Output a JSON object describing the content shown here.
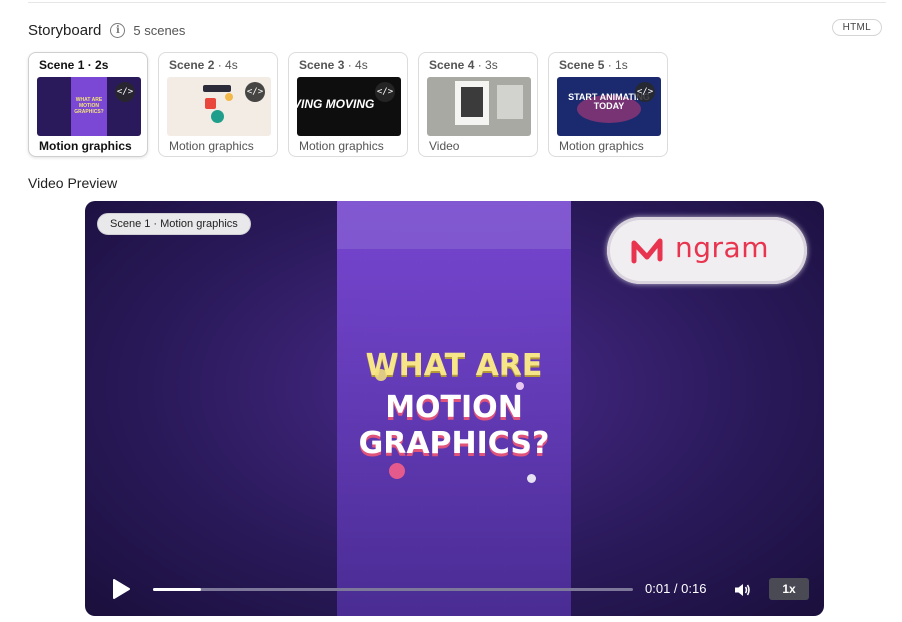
{
  "storyboard": {
    "title": "Storyboard",
    "scene_count": "5 scenes",
    "badge": "HTML"
  },
  "scenes": [
    {
      "label": "Scene 1",
      "duration": "· 2s",
      "type": "Motion graphics",
      "active": true,
      "thumb_text": "WHAT ARE MOTION GRAPHICS?"
    },
    {
      "label": "Scene 2",
      "duration": "· 4s",
      "type": "Motion graphics",
      "active": false
    },
    {
      "label": "Scene 3",
      "duration": "· 4s",
      "type": "Motion graphics",
      "active": false,
      "thumb_text": "VING MOVING"
    },
    {
      "label": "Scene 4",
      "duration": "· 3s",
      "type": "Video",
      "active": false
    },
    {
      "label": "Scene 5",
      "duration": "· 1s",
      "type": "Motion graphics",
      "active": false,
      "thumb_text": "START ANIMATING TODAY"
    }
  ],
  "preview": {
    "label": "Video Preview",
    "scene_tag": "Scene 1 · Motion graphics",
    "logo_text": "ngram",
    "title_line1": "WHAT ARE",
    "title_line2": "MOTION",
    "title_line3": "GRAPHICS?",
    "progress": 0.1,
    "time": "0:01 / 0:16",
    "speed": "1x"
  },
  "colors": {
    "accent_purple": "#7a48d6",
    "logo_red": "#e8344e",
    "title_yellow": "#f7e58a"
  }
}
